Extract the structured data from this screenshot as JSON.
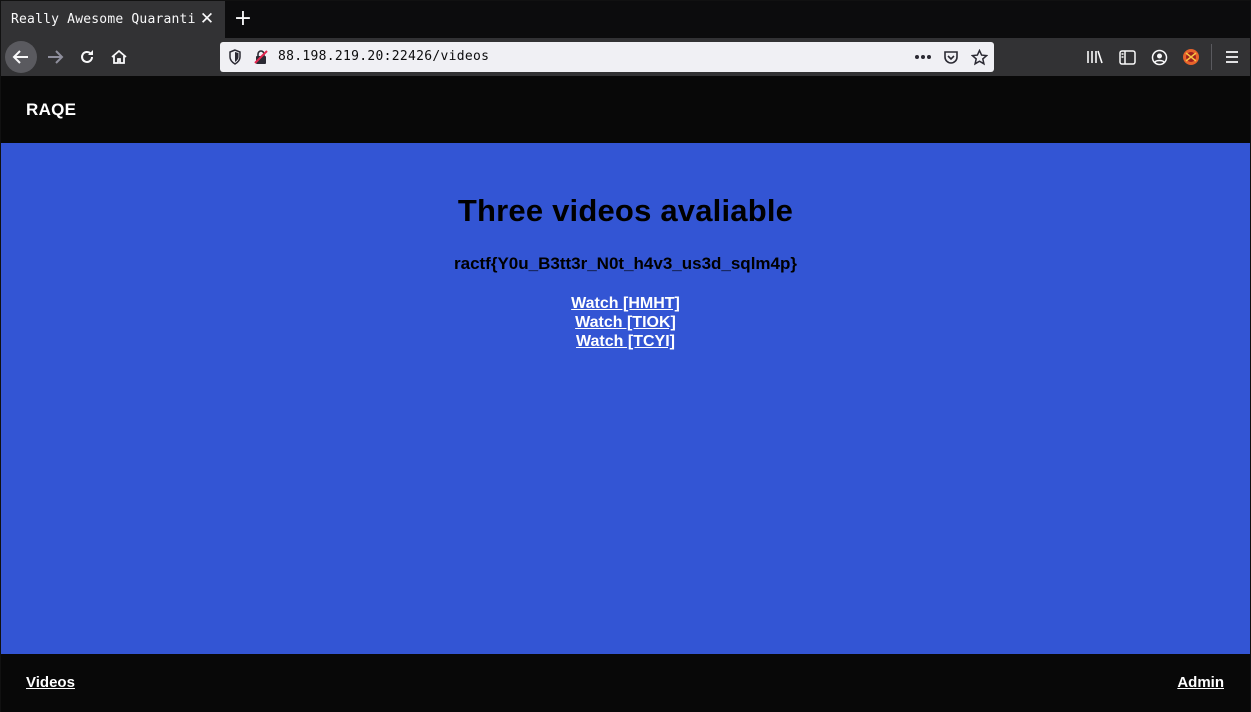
{
  "browser": {
    "tab_title": "Really Awesome Quaranti",
    "url": "88.198.219.20:22426/videos",
    "icons": {
      "tab_close": "close-icon",
      "new_tab": "plus-icon",
      "back": "back-arrow-icon",
      "forward": "forward-arrow-icon",
      "reload": "reload-icon",
      "home": "home-icon",
      "tracking": "shield-icon",
      "insecure": "insecure-lock-icon",
      "page_actions": "more-dots-icon",
      "pocket": "pocket-icon",
      "bookmark": "star-icon",
      "library": "library-icon",
      "sidebar": "sidebar-icon",
      "account": "account-icon",
      "extension": "extension-icon",
      "menu": "hamburger-menu-icon"
    }
  },
  "site": {
    "brand": "RAQE",
    "heading": "Three videos avaliable",
    "flag": "ractf{Y0u_B3tt3r_N0t_h4v3_us3d_sqlm4p}",
    "links": [
      {
        "label": "Watch [HMHT]"
      },
      {
        "label": "Watch [TIOK]"
      },
      {
        "label": "Watch [TCYI]"
      }
    ],
    "footer": {
      "left_link": "Videos",
      "right_link": "Admin"
    }
  },
  "colors": {
    "page_background": "#3355d4",
    "header_footer": "#080808",
    "browser_chrome": "#323234"
  }
}
